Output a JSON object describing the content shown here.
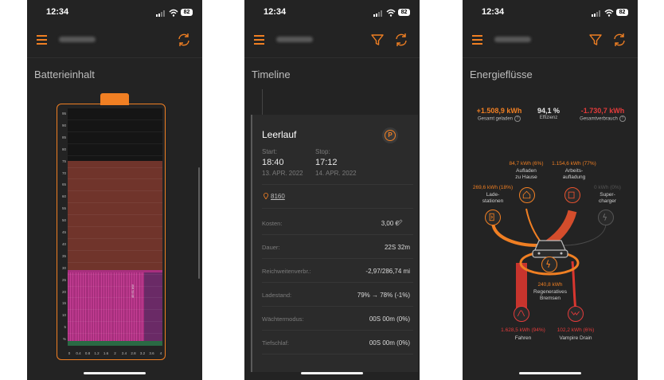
{
  "status": {
    "time": "12:34",
    "battery": "82"
  },
  "screens": {
    "battery": {
      "title": "Batterieinhalt",
      "vertical_label": "49.61 kW"
    },
    "timeline": {
      "title": "Timeline",
      "event": {
        "title": "Leerlauf",
        "start_label": "Start:",
        "start_time": "18:40",
        "start_date": "13. APR. 2022",
        "stop_label": "Stop:",
        "stop_time": "17:12",
        "stop_date": "14. APR. 2022",
        "location": "8160",
        "badge": "P"
      },
      "rows": [
        {
          "label": "Kosten:",
          "value": "3,00 €"
        },
        {
          "label": "Dauer:",
          "value": "22S 32m"
        },
        {
          "label": "Reichweitenverbr.:",
          "value": "-2,97/286,74 mi"
        },
        {
          "label": "Ladestand:",
          "value": "79% → 78% (-1%)"
        },
        {
          "label": "Wächtermodus:",
          "value": "00S 00m (0%)"
        },
        {
          "label": "Tiefschlaf:",
          "value": "00S 00m (0%)"
        }
      ]
    },
    "energy": {
      "title": "Energieflüsse",
      "stats": [
        {
          "value": "+1.508,9 kWh",
          "label": "Gesamt geladen",
          "color": "#f07f23"
        },
        {
          "value": "94,1 %",
          "label": "Effizienz",
          "color": "#e8e8e8"
        },
        {
          "value": "-1.730,7 kWh",
          "label": "Gesamtverbrauch",
          "color": "#e43b3b"
        }
      ],
      "flows": {
        "home": {
          "value": "84,7 kWh (6%)",
          "label": "Aufladen\nzu Hause"
        },
        "work": {
          "value": "1.154,6 kWh (77%)",
          "label": "Arbeits-\naufladung"
        },
        "stations": {
          "value": "269,6 kWh (18%)",
          "label": "Lade-\nstationen"
        },
        "supercharger": {
          "value": "0 kWh (0%)",
          "label": "Super-\ncharger"
        },
        "regen": {
          "value": "240,8 kWh",
          "label": "Regeneratives\nBremsen"
        },
        "driving": {
          "value": "1.628,5 kWh (94%)",
          "label": "Fahren"
        },
        "vampire": {
          "value": "102,2 kWh (6%)",
          "label": "Vampire Drain"
        }
      }
    }
  },
  "chart_data": {
    "type": "bar",
    "title": "Batterieinhalt",
    "x_ticks": [
      "0",
      "0.4",
      "0.8",
      "1.2",
      "1.6",
      "2",
      "2.4",
      "2.8",
      "3.2",
      "3.6",
      "4"
    ],
    "y_ticks": [
      "95",
      "90",
      "85",
      "80",
      "75",
      "70",
      "65",
      "60",
      "55",
      "50",
      "45",
      "40",
      "35",
      "30",
      "25",
      "20",
      "15",
      "10",
      "5",
      "%"
    ],
    "ylim": [
      0,
      100
    ],
    "bands": [
      {
        "from": 0,
        "to": 2,
        "color": "#2a6a44"
      },
      {
        "from": 2,
        "to": 32,
        "color": "#a82f7e"
      },
      {
        "from": 32,
        "to": 78,
        "color": "#70342b"
      },
      {
        "from": 78,
        "to": 100,
        "color": "#151515"
      }
    ],
    "highlighted_level": 31
  },
  "colors": {
    "accent": "#f07f23",
    "danger": "#e43b3b",
    "background": "#232323"
  }
}
